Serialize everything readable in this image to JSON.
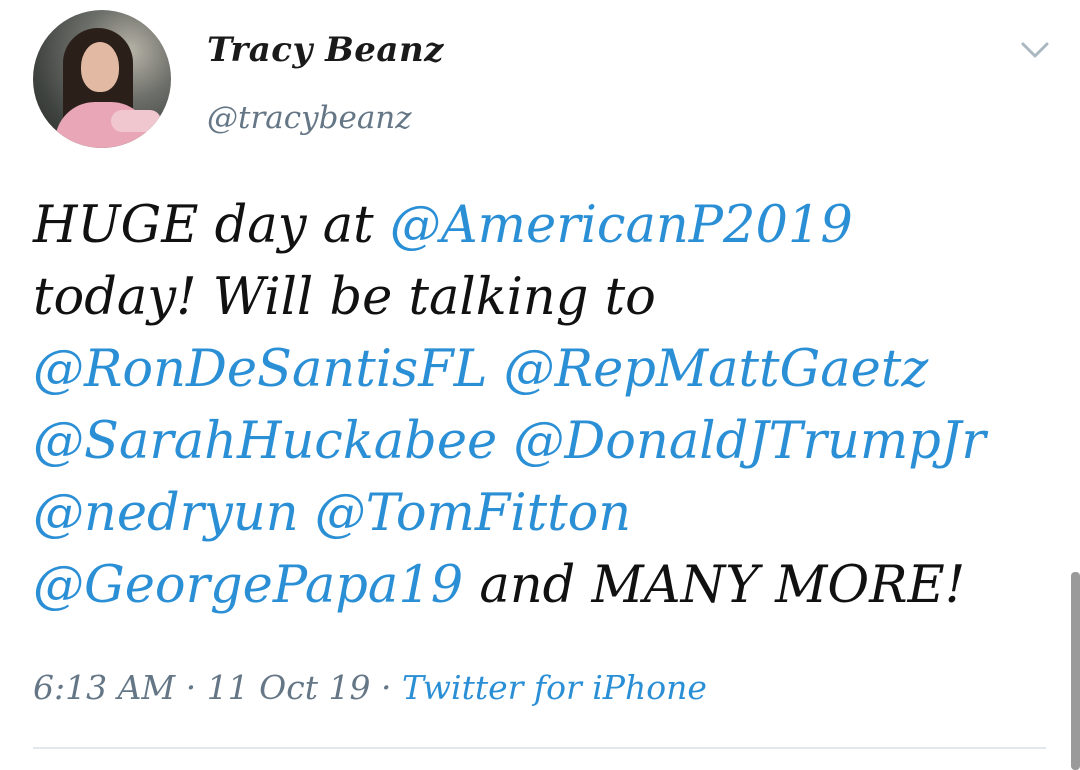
{
  "author": {
    "display_name": "Tracy Beanz",
    "handle": "@tracybeanz",
    "avatar_icon": "profile-photo"
  },
  "menu": {
    "icon": "chevron-down-icon"
  },
  "tweet": {
    "line1_text": "HUGE day at ",
    "line1_mention": "@AmericanP2019",
    "line2_text": "today! Will be talking to",
    "mention_1": "@RonDeSantisFL",
    "mention_2": "@RepMattGaetz",
    "mention_3": "@SarahHuckabee",
    "mention_4": "@DonaldJTrumpJr",
    "mention_5": "@nedryun",
    "mention_6": "@TomFitton",
    "mention_7": "@GeorgePapa19",
    "closing_text": " and MANY MORE!"
  },
  "meta": {
    "time": "6:13 AM",
    "separator_1": " · ",
    "date": "11 Oct 19",
    "separator_2": " · ",
    "source": "Twitter for iPhone"
  },
  "colors": {
    "link": "#2b8fd6",
    "muted": "#657786",
    "text": "#111111"
  }
}
